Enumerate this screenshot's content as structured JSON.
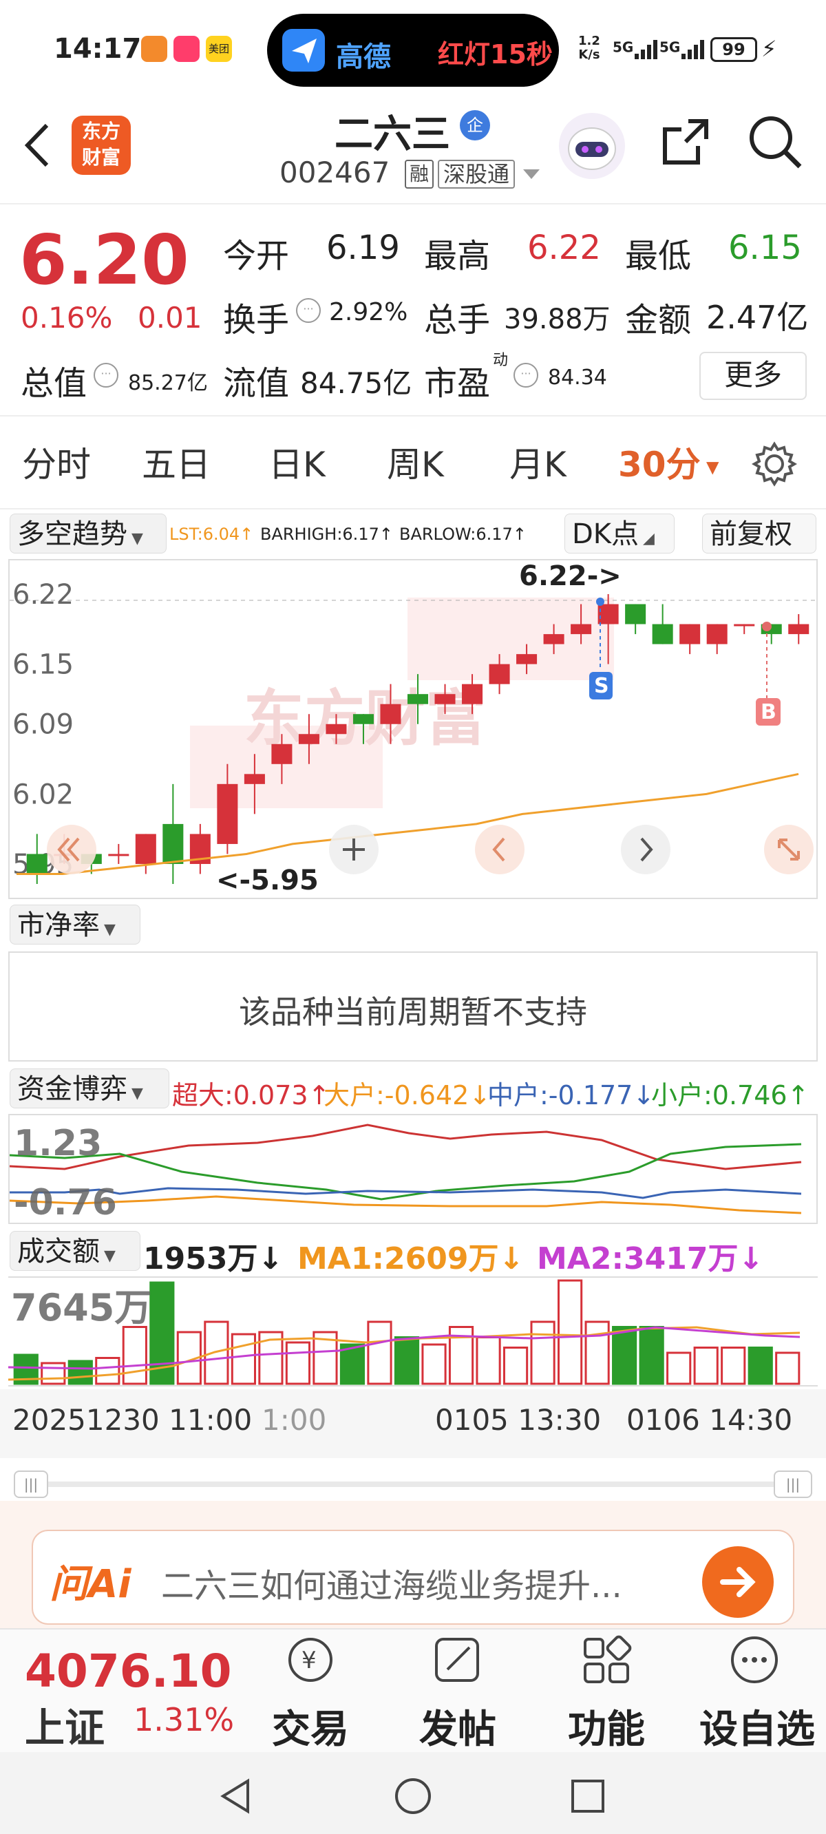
{
  "status": {
    "time": "14:17",
    "island_app": "高德",
    "island_text": "红灯15秒",
    "net_speed_top": "1.2",
    "net_speed_bottom": "K/s",
    "net1": "5G",
    "net2": "5G",
    "battery": "99",
    "meituan": "美团"
  },
  "header": {
    "logo_line1": "东方",
    "logo_line2": "财富",
    "stock_name": "二六三",
    "enterprise_badge": "企",
    "code": "002467",
    "margin_tag": "融",
    "exchange": "深股通"
  },
  "quote": {
    "price": "6.20",
    "change_pct": "0.16%",
    "change_abs": "0.01",
    "open_label": "今开",
    "open": "6.19",
    "high_label": "最高",
    "high": "6.22",
    "low_label": "最低",
    "low": "6.15",
    "turnover_label": "换手",
    "turnover": "2.92%",
    "volume_label": "总手",
    "volume": "39.88万",
    "amount_label": "金额",
    "amount": "2.47亿",
    "total_mv_label": "总值",
    "total_mv": "85.27亿",
    "float_mv_label": "流值",
    "float_mv": "84.75亿",
    "pe_label": "市盈",
    "pe_sup": "动",
    "pe": "84.34",
    "more_label": "更多"
  },
  "tabs": [
    "分时",
    "五日",
    "日K",
    "周K",
    "月K",
    "30分"
  ],
  "kline": {
    "indicator_name": "多空趋势",
    "lst": "LST:6.04↑",
    "barhigh": "BARHIGH:6.17↑",
    "barlow": "BARLOW:6.17↑",
    "dk_button": "DK点",
    "adjust_button": "前复权",
    "yticks": [
      "6.22",
      "6.15",
      "6.09",
      "6.02",
      "5.95"
    ],
    "max_label": "6.22->",
    "min_label": "<-5.95",
    "sell_marker": "S",
    "buy_marker": "B",
    "watermark": "东方财富"
  },
  "pb_panel": {
    "name": "市净率",
    "message": "该品种当前周期暂不支持"
  },
  "fund": {
    "name": "资金博弈",
    "super": "超大:0.073↑",
    "big": "大户:-0.642↓",
    "mid": "中户:-0.177↓",
    "small": "小户:0.746↑",
    "ytop": "1.23",
    "ybottom": "-0.76"
  },
  "volume": {
    "name": "成交额",
    "value": "1953万↓",
    "ma1": "MA1:2609万↓",
    "ma2": "MA2:3417万↓",
    "ymax": "7645万"
  },
  "xaxis": [
    "20251230 11:00",
    "1:00",
    "0105 13:30",
    "0106 14:30"
  ],
  "ai": {
    "logo": "问Ai",
    "prompt": "二六三如何通过海缆业务提升..."
  },
  "bottom": {
    "index_value": "4076.10",
    "index_name": "上证",
    "index_change": "1.31%",
    "trade": "交易",
    "post": "发帖",
    "features": "功能",
    "watchlist": "设自选"
  },
  "colors": {
    "up": "#d6323a",
    "down": "#2b9c2b",
    "accent": "#f06a1e"
  },
  "chart_data": {
    "type": "candlestick",
    "ylim": [
      5.93,
      6.24
    ],
    "candles": [
      {
        "o": 5.96,
        "h": 5.98,
        "l": 5.93,
        "c": 5.94
      },
      {
        "o": 5.96,
        "h": 5.98,
        "l": 5.95,
        "c": 5.96
      },
      {
        "o": 5.96,
        "h": 5.96,
        "l": 5.94,
        "c": 5.95
      },
      {
        "o": 5.96,
        "h": 5.97,
        "l": 5.95,
        "c": 5.96
      },
      {
        "o": 5.95,
        "h": 5.98,
        "l": 5.94,
        "c": 5.98
      },
      {
        "o": 5.99,
        "h": 6.03,
        "l": 5.93,
        "c": 5.95
      },
      {
        "o": 5.95,
        "h": 5.99,
        "l": 5.94,
        "c": 5.98
      },
      {
        "o": 5.97,
        "h": 6.05,
        "l": 5.96,
        "c": 6.03
      },
      {
        "o": 6.03,
        "h": 6.06,
        "l": 6.0,
        "c": 6.04
      },
      {
        "o": 6.05,
        "h": 6.08,
        "l": 6.03,
        "c": 6.07
      },
      {
        "o": 6.07,
        "h": 6.1,
        "l": 6.05,
        "c": 6.08
      },
      {
        "o": 6.08,
        "h": 6.1,
        "l": 6.07,
        "c": 6.09
      },
      {
        "o": 6.1,
        "h": 6.1,
        "l": 6.07,
        "c": 6.09
      },
      {
        "o": 6.09,
        "h": 6.13,
        "l": 6.07,
        "c": 6.11
      },
      {
        "o": 6.12,
        "h": 6.14,
        "l": 6.09,
        "c": 6.11
      },
      {
        "o": 6.11,
        "h": 6.13,
        "l": 6.1,
        "c": 6.12
      },
      {
        "o": 6.11,
        "h": 6.14,
        "l": 6.1,
        "c": 6.13
      },
      {
        "o": 6.13,
        "h": 6.16,
        "l": 6.12,
        "c": 6.15
      },
      {
        "o": 6.15,
        "h": 6.17,
        "l": 6.14,
        "c": 6.16
      },
      {
        "o": 6.17,
        "h": 6.19,
        "l": 6.16,
        "c": 6.18
      },
      {
        "o": 6.18,
        "h": 6.21,
        "l": 6.17,
        "c": 6.19
      },
      {
        "o": 6.19,
        "h": 6.22,
        "l": 6.15,
        "c": 6.21
      },
      {
        "o": 6.21,
        "h": 6.21,
        "l": 6.18,
        "c": 6.19
      },
      {
        "o": 6.19,
        "h": 6.21,
        "l": 6.17,
        "c": 6.17
      },
      {
        "o": 6.17,
        "h": 6.19,
        "l": 6.16,
        "c": 6.19
      },
      {
        "o": 6.17,
        "h": 6.19,
        "l": 6.16,
        "c": 6.19
      },
      {
        "o": 6.19,
        "h": 6.19,
        "l": 6.18,
        "c": 6.19
      },
      {
        "o": 6.19,
        "h": 6.19,
        "l": 6.17,
        "c": 6.18
      },
      {
        "o": 6.18,
        "h": 6.2,
        "l": 6.17,
        "c": 6.19
      }
    ],
    "ma_line": [
      5.94,
      5.94,
      5.945,
      5.95,
      5.955,
      5.96,
      5.97,
      5.975,
      5.98,
      5.985,
      5.99,
      6.0,
      6.005,
      6.01,
      6.015,
      6.02,
      6.03,
      6.04
    ]
  }
}
